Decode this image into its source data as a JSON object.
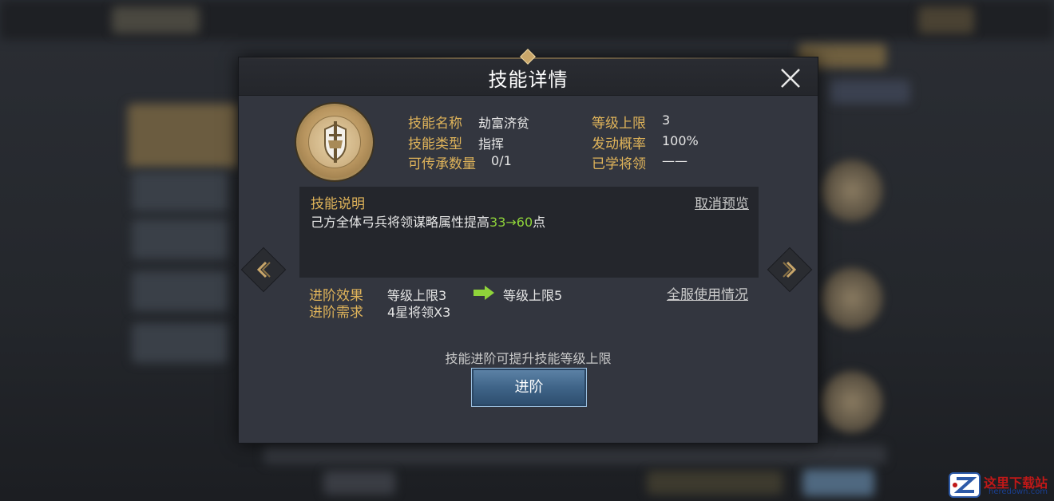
{
  "modal": {
    "title": "技能详情"
  },
  "skill": {
    "fields_left": [
      {
        "label": "技能名称",
        "value": "劫富济贫"
      },
      {
        "label": "技能类型",
        "value": "指挥"
      },
      {
        "label": "可传承数量",
        "value": "0/1"
      }
    ],
    "fields_right": [
      {
        "label": "等级上限",
        "value": "3"
      },
      {
        "label": "发动概率",
        "value": "100%"
      },
      {
        "label": "已学将领",
        "value": "——"
      }
    ]
  },
  "description": {
    "title": "技能说明",
    "cancel_preview": "取消预览",
    "text_prefix": "己方全体弓兵将领谋略属性提高",
    "value_from": "33",
    "arrow": "→",
    "value_to": "60",
    "text_suffix": "点"
  },
  "advance": {
    "effect_label": "进阶效果",
    "effect_from": "等级上限3",
    "effect_to": "等级上限5",
    "requirement_label": "进阶需求",
    "requirement_value": "4星将领X3",
    "all_server_link": "全服使用情况",
    "hint": "技能进阶可提升技能等级上限",
    "button_label": "进阶"
  },
  "icons": {
    "close": "close-icon",
    "emblem": "skill-emblem-icon",
    "prev": "chevron-left-icon",
    "next": "chevron-right-icon",
    "arrow": "arrow-right-icon"
  },
  "colors": {
    "label_gold": "#e0b45a",
    "highlight_green": "#8fd43a",
    "button_blue": "#3f6488"
  },
  "watermark": {
    "name": "这里下载站",
    "url": "heredown.com"
  }
}
